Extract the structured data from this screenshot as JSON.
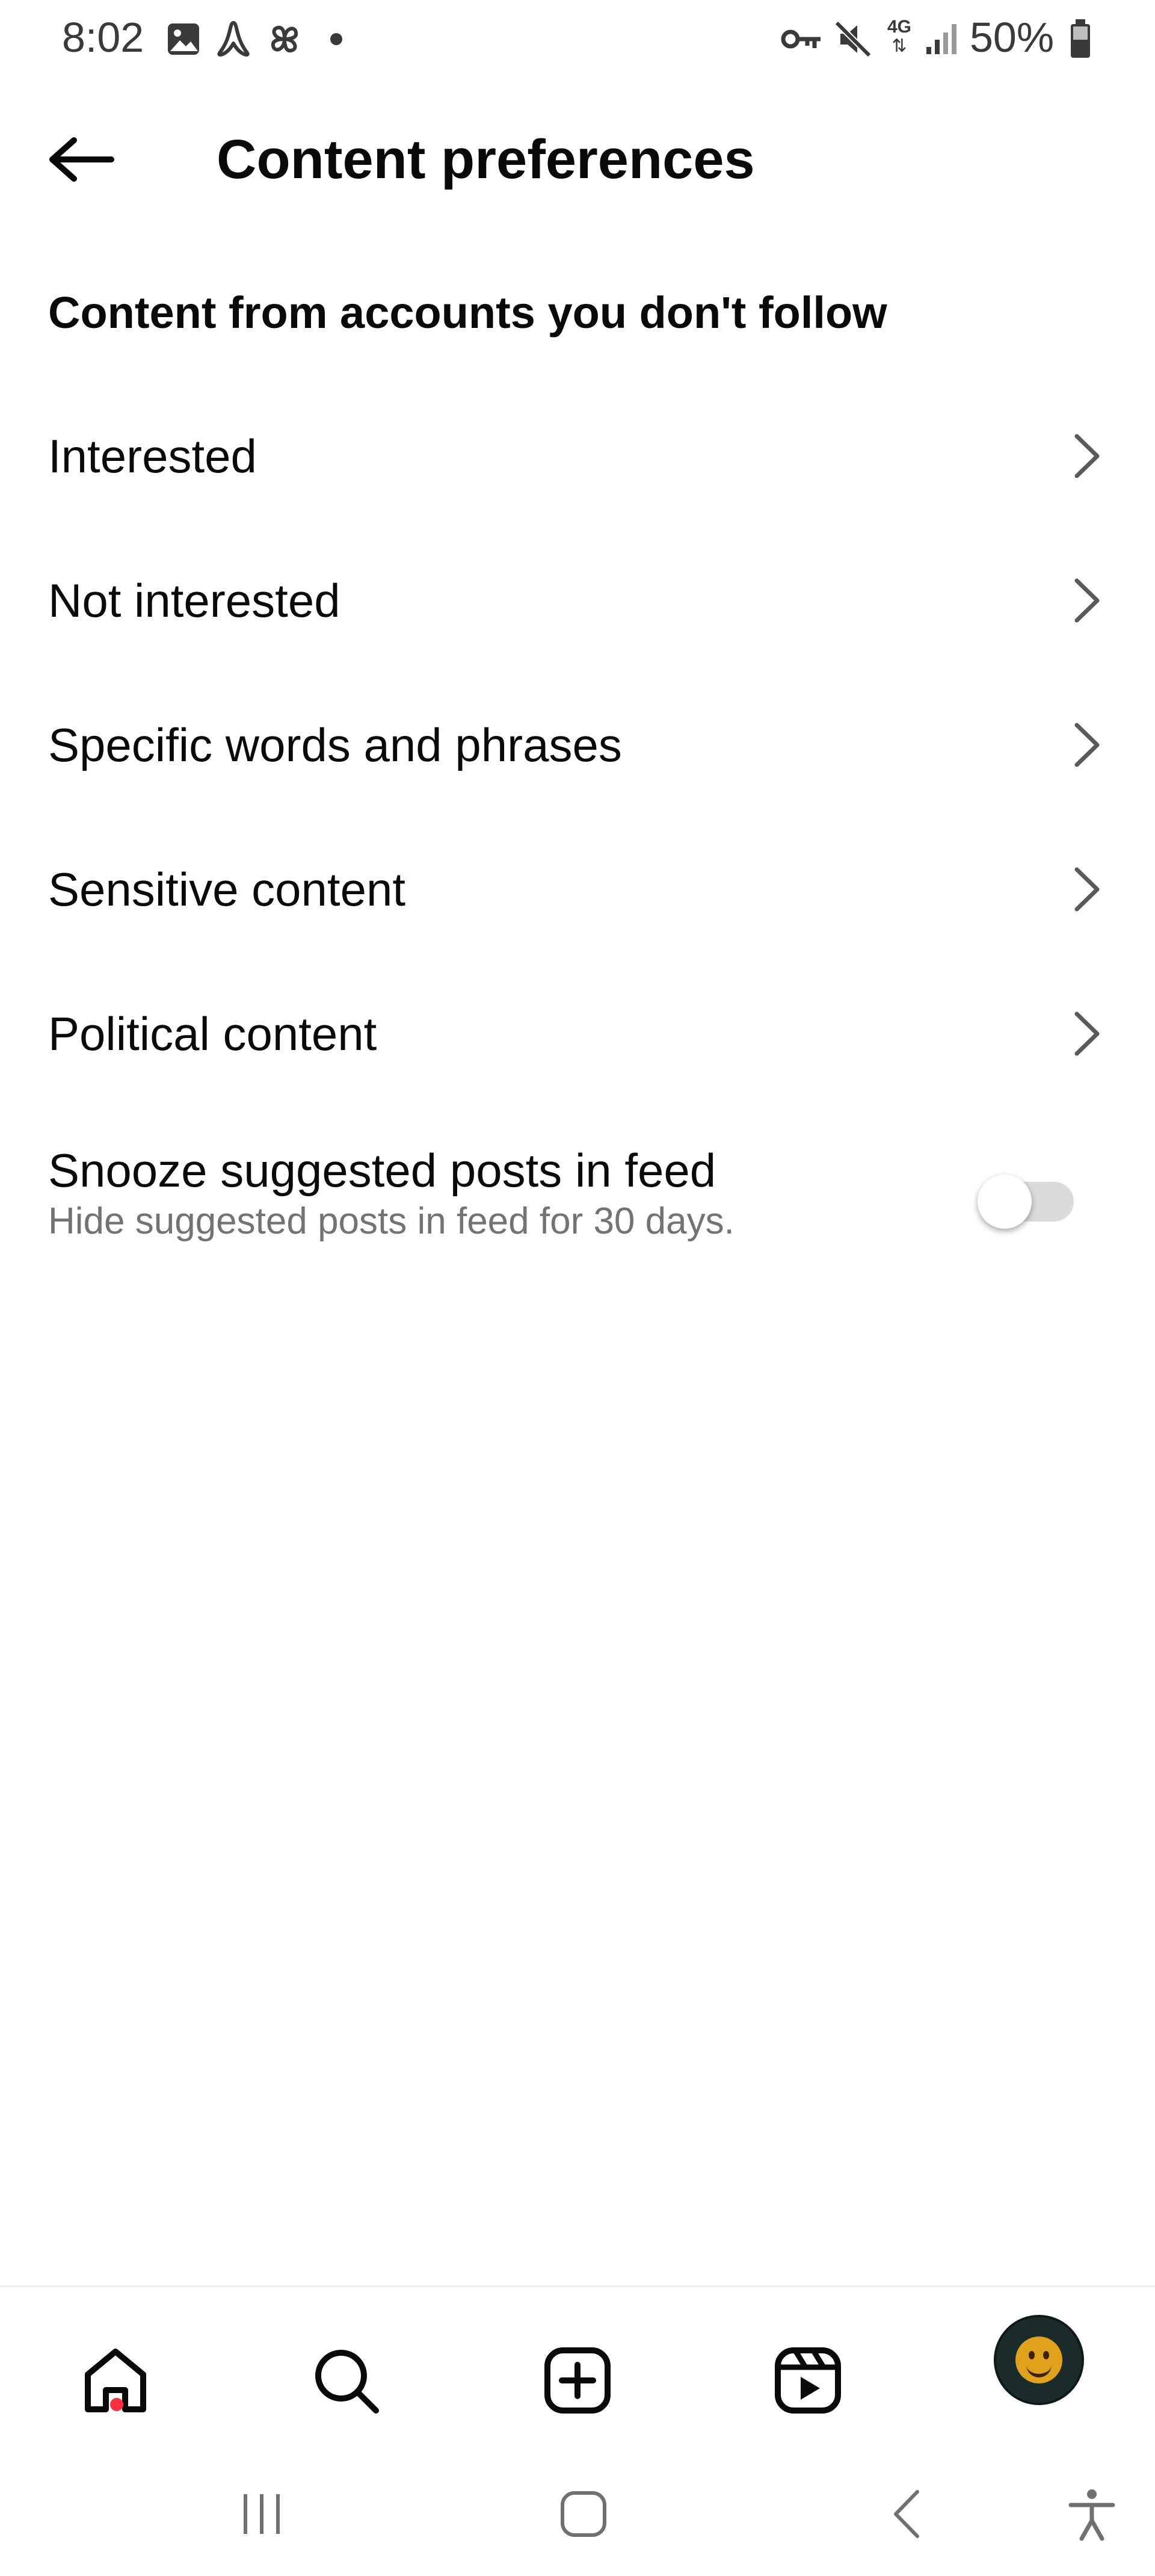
{
  "status_bar": {
    "time": "8:02",
    "battery": "50%",
    "network": "4G",
    "left_icons": [
      "gallery-icon",
      "acrobat-icon",
      "pinwheel-icon",
      "dot-icon"
    ],
    "right_icons": [
      "vpn-key-icon",
      "mute-icon",
      "network-4g-icon",
      "signal-icon",
      "battery-icon"
    ]
  },
  "header": {
    "title": "Content preferences",
    "back_icon": "arrow-left-icon"
  },
  "section": {
    "heading": "Content from accounts you don't follow"
  },
  "menu_items": [
    {
      "label": "Interested"
    },
    {
      "label": "Not interested"
    },
    {
      "label": "Specific words and phrases"
    },
    {
      "label": "Sensitive content"
    },
    {
      "label": "Political content"
    }
  ],
  "snooze": {
    "title": "Snooze suggested posts in feed",
    "subtitle": "Hide suggested posts in feed for 30 days.",
    "enabled": false
  },
  "bottom_nav": {
    "items": [
      "home-icon",
      "search-icon",
      "create-icon",
      "reels-icon",
      "profile-avatar"
    ],
    "notification_color": "#ff3040"
  },
  "system_nav": {
    "items": [
      "recents-icon",
      "home-button-icon",
      "back-icon",
      "accessibility-icon"
    ]
  },
  "colors": {
    "text": "#0a0a0a",
    "secondary_text": "#737373",
    "toggle_off": "#dbdbdb"
  }
}
